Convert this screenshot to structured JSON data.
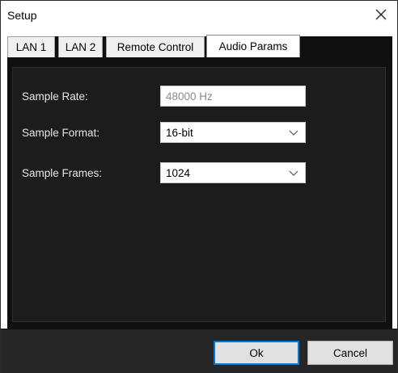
{
  "window": {
    "title": "Setup"
  },
  "tabs": [
    {
      "label": "LAN 1"
    },
    {
      "label": "LAN 2"
    },
    {
      "label": "Remote Control"
    },
    {
      "label": "Audio Params",
      "active": true
    }
  ],
  "form": {
    "sample_rate": {
      "label": "Sample Rate:",
      "value": "48000 Hz"
    },
    "sample_format": {
      "label": "Sample Format:",
      "value": "16-bit"
    },
    "sample_frames": {
      "label": "Sample Frames:",
      "value": "1024"
    }
  },
  "buttons": {
    "ok": "Ok",
    "cancel": "Cancel"
  },
  "colors": {
    "accent": "#0078d7",
    "panel_bg": "#1c1c1c",
    "footer_bg": "#262626"
  },
  "icons": {
    "close": "close-icon",
    "dropdown": "chevron-down-icon"
  }
}
